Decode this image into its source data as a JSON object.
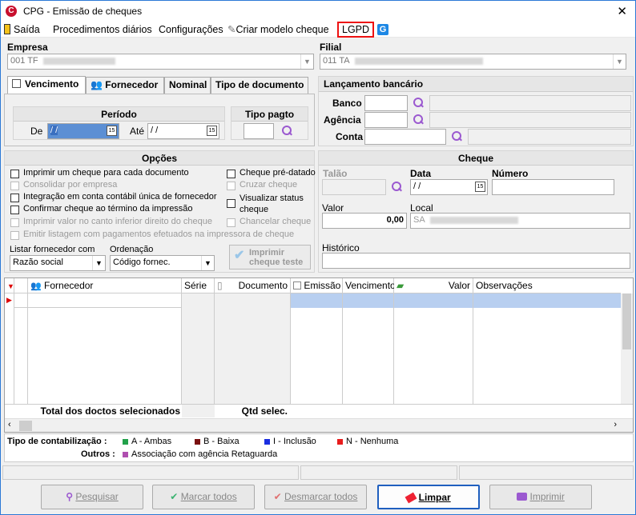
{
  "window": {
    "title": "CPG - Emissão de cheques"
  },
  "menu": {
    "saida": "Saída",
    "procedimentos": "Procedimentos diários",
    "configuracoes": "Configurações",
    "criar_modelo": "Criar modelo cheque",
    "lgpd": "LGPD"
  },
  "empresa": {
    "label": "Empresa",
    "value": "001 TF"
  },
  "filial": {
    "label": "Filial",
    "value": "011 TA"
  },
  "tabs": [
    "Vencimento",
    "Fornecedor",
    "Nominal",
    "Tipo de documento"
  ],
  "periodo": {
    "title": "Período",
    "de_label": "De",
    "de_value": " / /",
    "ate_label": "Até",
    "ate_value": " / /"
  },
  "tipo_pagto": {
    "title": "Tipo pagto"
  },
  "lancamento": {
    "title": "Lançamento bancário",
    "banco": "Banco",
    "agencia": "Agência",
    "conta": "Conta"
  },
  "opcoes": {
    "title": "Opções",
    "items": [
      "Imprimir um cheque para cada documento",
      "Consolidar por empresa",
      "Integração em conta contábil única de fornecedor",
      "Confirmar cheque ao término da impressão",
      "Imprimir valor no canto inferior direito do cheque",
      "Emitir listagem com pagamentos efetuados na impressora de cheque"
    ],
    "right_items": [
      "Cheque pré-datado",
      "Cruzar cheque",
      "Visualizar status",
      "cheque",
      "Chancelar cheque"
    ],
    "listar_label": "Listar fornecedor com",
    "listar_value": "Razão social",
    "ordenacao_label": "Ordenação",
    "ordenacao_value": "Código fornec.",
    "imprimir_teste_1": "Imprimir",
    "imprimir_teste_2": "cheque teste"
  },
  "cheque": {
    "title": "Cheque",
    "talao": "Talão",
    "data": "Data",
    "data_value": " / /",
    "numero": "Número",
    "valor": "Valor",
    "valor_value": "0,00",
    "local": "Local",
    "local_value": "SA",
    "historico": "Histórico"
  },
  "grid": {
    "columns": [
      "Fornecedor",
      "Série",
      "Documento",
      "Emissão",
      "Vencimento",
      "Valor",
      "Observações"
    ],
    "footer_total": "Total dos doctos selecionados",
    "footer_qtd": "Qtd selec."
  },
  "legend": {
    "tipo_label": "Tipo de contabilização :",
    "outros_label": "Outros :",
    "items": [
      {
        "text": "A - Ambas",
        "color": "#22a14a"
      },
      {
        "text": "B - Baixa",
        "color": "#7a1010"
      },
      {
        "text": "I - Inclusão",
        "color": "#1a2ee0"
      },
      {
        "text": "N - Nenhuma",
        "color": "#e81c1c"
      }
    ],
    "outros": {
      "text": "Associação com agência Retaguarda",
      "color": "#b04fb0"
    }
  },
  "buttons": {
    "pesquisar": "Pesquisar",
    "marcar": "Marcar todos",
    "desmarcar": "Desmarcar todos",
    "limpar": "Limpar",
    "imprimir": "Imprimir"
  }
}
